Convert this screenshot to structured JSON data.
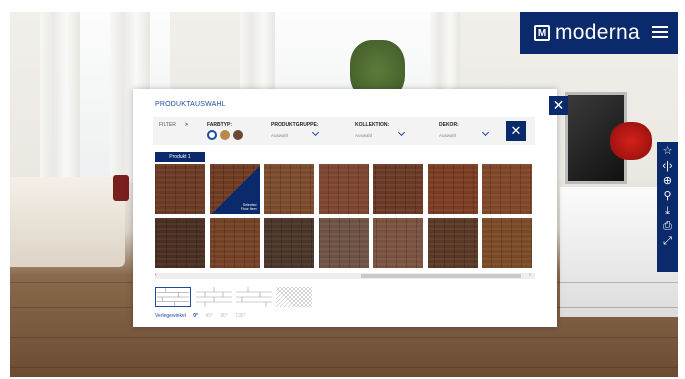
{
  "brand": {
    "name": "moderna",
    "logo_letter": "M",
    "color": "#0b2a6b"
  },
  "panel": {
    "title": "PRODUKTAUSWAHL",
    "filter_label": "FILTER",
    "filter_arrow": ">",
    "farbtyp_label": "FARBTYP:",
    "farbtyp_swatches": [
      "#ffffff",
      "#b88a4a",
      "#6b4a35"
    ],
    "produktgruppe_label": "PRODUKTGRUPPE:",
    "produktgruppe_value": "Auswahl",
    "kollektion_label": "KOLLEKTION:",
    "kollektion_value": "Auswahl",
    "dekor_label": "DEKOR:",
    "dekor_value": "Auswahl",
    "tab_label": "Produkt 1",
    "selected_tile_text": "Selected\nFloor Item",
    "laying_label": "Verlegewinkel",
    "angles": [
      "0°",
      "45°",
      "90°",
      "135°"
    ]
  },
  "tiles": [
    {
      "color": "#6b3a24"
    },
    {
      "color": "#6e3b22"
    },
    {
      "color": "#7a4a2c"
    },
    {
      "color": "#7b4530"
    },
    {
      "color": "#6a3926"
    },
    {
      "color": "#7b3c24"
    },
    {
      "color": "#7f4628"
    },
    {
      "color": "#4a2e22"
    },
    {
      "color": "#744126"
    },
    {
      "color": "#4b3429"
    },
    {
      "color": "#6d5243"
    },
    {
      "color": "#7a5240"
    },
    {
      "color": "#5a3826"
    },
    {
      "color": "#7a4a26"
    }
  ],
  "toolbar_icons": [
    "star-icon",
    "compare-icon",
    "zoom-icon",
    "link-icon",
    "download-icon",
    "print-icon",
    "fullscreen-icon"
  ]
}
